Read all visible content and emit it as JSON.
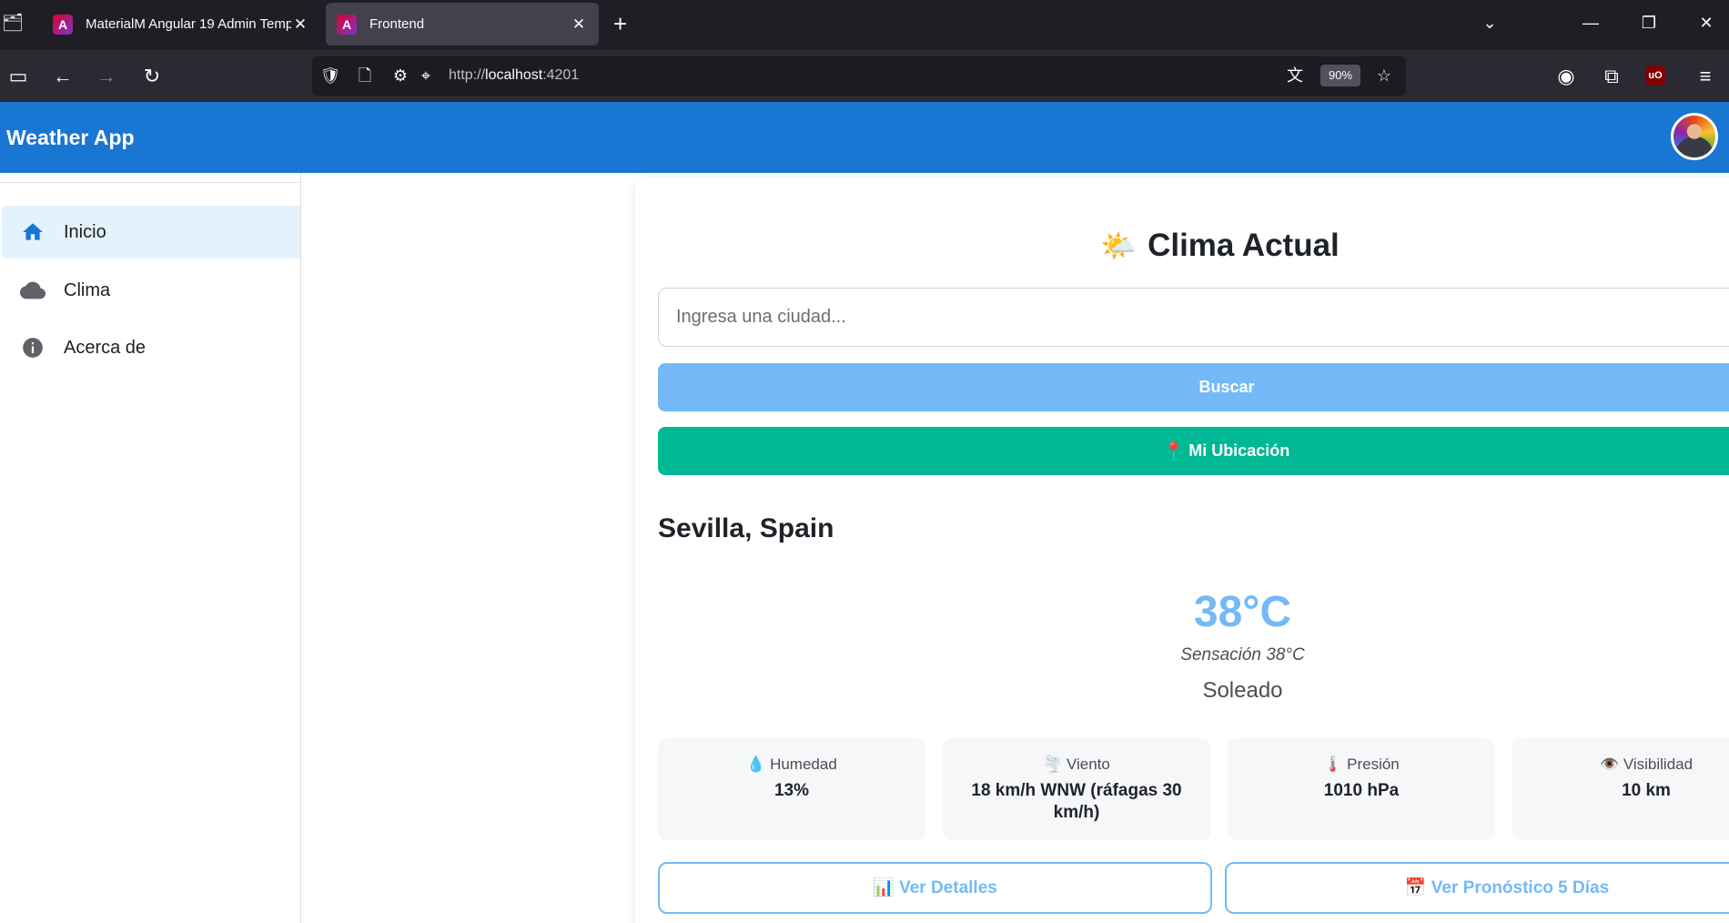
{
  "browser": {
    "tabs": [
      {
        "title": "MaterialM Angular 19 Admin Template",
        "favicon": "angular-logo-icon",
        "active": false
      },
      {
        "title": "Frontend",
        "favicon": "angular-logo-icon",
        "active": true
      }
    ],
    "url": {
      "prefix": "http://",
      "host": "localhost",
      "port": ":4201"
    },
    "zoom": "90%"
  },
  "app": {
    "title": "Weather App",
    "accent_color": "#1976d2"
  },
  "sidebar": {
    "items": [
      {
        "label": "Inicio",
        "icon": "home-icon",
        "active": true
      },
      {
        "label": "Clima",
        "icon": "cloud-icon",
        "active": false
      },
      {
        "label": "Acerca de",
        "icon": "info-icon",
        "active": false
      }
    ]
  },
  "weather": {
    "title": "Clima Actual",
    "title_emoji": "🌤️",
    "search": {
      "placeholder": "Ingresa una ciudad...",
      "value": ""
    },
    "search_button": "Buscar",
    "location_button": "📍 Mi Ubicación",
    "city": "Sevilla, Spain",
    "temperature": "38°C",
    "feels_like": "Sensación 38°C",
    "condition": "Soleado",
    "stats": [
      {
        "label": "💧 Humedad",
        "value": "13%"
      },
      {
        "label": "🌪️ Viento",
        "value": "18 km/h WNW (ráfagas 30 km/h)"
      },
      {
        "label": "🌡️ Presión",
        "value": "1010 hPa"
      },
      {
        "label": "👁️ Visibilidad",
        "value": "10 km"
      }
    ],
    "details_button": "📊 Ver Detalles",
    "forecast_button": "📅 Ver Pronóstico 5 Días",
    "colors": {
      "primary_light": "#74b9f7",
      "success": "#00b894"
    }
  }
}
